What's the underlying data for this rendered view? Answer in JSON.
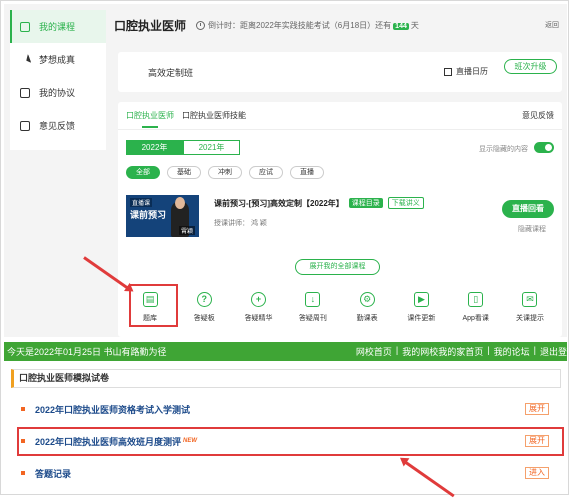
{
  "sidebar": {
    "items": [
      {
        "label": "我的课程",
        "icon": "course-icon",
        "active": true
      },
      {
        "label": "梦想成真",
        "icon": "paper-plane-icon"
      },
      {
        "label": "我的协议",
        "icon": "agreement-icon"
      },
      {
        "label": "意见反馈",
        "icon": "feedback-icon"
      }
    ]
  },
  "header": {
    "title": "口腔执业医师",
    "countdown_prefix": "倒计时：距离2022年实践技能考试（6月18日）还有",
    "days": "144",
    "countdown_suffix": "天",
    "back": "返回"
  },
  "class_card": {
    "class_name": "高效定制班",
    "calendar": "直播日历",
    "upgrade": "班次升级"
  },
  "course_card": {
    "tabs": [
      "口腔执业医师",
      "口腔执业医师技能"
    ],
    "feedback": "意见反馈",
    "years": [
      "2022年",
      "2021年"
    ],
    "show_hidden": "显示隐藏的内容",
    "filters": [
      "全部",
      "基础",
      "冲刺",
      "应试",
      "直播"
    ],
    "course": {
      "thumb_tag": "直播课",
      "thumb_title": "课前预习",
      "thumb_name": "霄颖",
      "title": "课前预习-[预习]高效定制【2022年】",
      "badge1": "课程目录",
      "badge2": "下载讲义",
      "teacher": "授课讲师：  鸿  颖",
      "replay": "直播回看",
      "hide": "隐藏课程"
    },
    "expand_all": "展开我的全部课程",
    "tools": [
      {
        "label": "题库",
        "icon": "question-bank-icon",
        "glyph": "▤"
      },
      {
        "label": "答疑板",
        "icon": "qa-board-icon",
        "glyph": "?"
      },
      {
        "label": "答疑精华",
        "icon": "qa-essence-icon",
        "glyph": "+"
      },
      {
        "label": "答疑周刊",
        "icon": "qa-weekly-icon",
        "glyph": "↓"
      },
      {
        "label": "勤课表",
        "icon": "timetable-icon",
        "glyph": "⚙"
      },
      {
        "label": "课件更新",
        "icon": "courseware-update-icon",
        "glyph": "▶"
      },
      {
        "label": "App看课",
        "icon": "app-icon",
        "glyph": "▯"
      },
      {
        "label": "关课提示",
        "icon": "mail-icon",
        "glyph": "✉"
      }
    ]
  },
  "bottom_bar": {
    "date_text": "今天是2022年01月25日  书山有路勤为径",
    "links": [
      "网校首页",
      "|",
      "我的网校我的家首页",
      "|",
      "我的论坛",
      "|",
      "退出登"
    ]
  },
  "exam_section": {
    "title": "口腔执业医师模拟试卷",
    "rows": [
      {
        "label": "2022年口腔执业医师资格考试入学测试",
        "action": "展开",
        "new": ""
      },
      {
        "label": "2022年口腔执业医师高效班月度测评",
        "action": "展开",
        "new": "NEW"
      },
      {
        "label": "答题记录",
        "action": "进入",
        "new": ""
      }
    ]
  },
  "colors": {
    "accent": "#2bb24c",
    "highlight": "#e03b3b",
    "link": "#1c4a8a",
    "orange": "#f26522"
  }
}
